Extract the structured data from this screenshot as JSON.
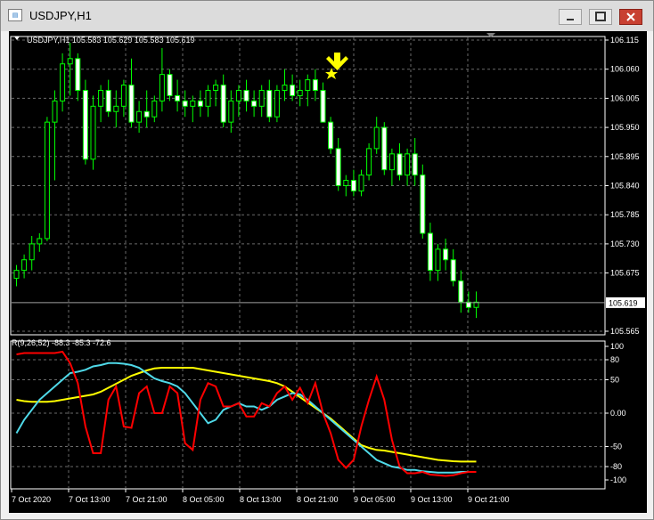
{
  "window": {
    "title": "USDJPY,H1"
  },
  "chart": {
    "header": "USDJPY,H1  105.583 105.629 105.583 105.619",
    "bid_label": "105.619",
    "price_labels": [
      "106.115",
      "106.060",
      "106.005",
      "105.950",
      "105.895",
      "105.840",
      "105.785",
      "105.730",
      "105.675",
      "105.565"
    ],
    "time_labels": [
      "7 Oct 2020",
      "7 Oct 13:00",
      "7 Oct 21:00",
      "8 Oct 05:00",
      "8 Oct 13:00",
      "8 Oct 21:00",
      "9 Oct 05:00",
      "9 Oct 13:00",
      "9 Oct 21:00"
    ],
    "signal_marks": [
      "down-arrow-icon",
      "star-icon"
    ]
  },
  "indicator": {
    "header": "R(9,26,52) -88.3 -85.3 -72.6",
    "levels": [
      "100",
      "80",
      "50",
      "0.00",
      "-50",
      "-80",
      "-100"
    ]
  },
  "colors": {
    "background": "#000000",
    "bull_candle": "#00ff00",
    "bear_candle": "#ffffff",
    "grid": "#6a6a6a",
    "signal": "#ffff00",
    "fast_line": "#ff0000",
    "mid_line": "#4fd9e8",
    "slow_line": "#ffff00"
  },
  "chart_data": {
    "type": "candlestick",
    "symbol": "USDJPY",
    "timeframe": "H1",
    "ylim": [
      105.565,
      106.115
    ],
    "candles": [
      [
        105.665,
        105.69,
        105.65,
        105.68
      ],
      [
        105.68,
        105.71,
        105.665,
        105.7
      ],
      [
        105.7,
        105.745,
        105.68,
        105.73
      ],
      [
        105.73,
        105.75,
        105.715,
        105.74
      ],
      [
        105.74,
        105.97,
        105.735,
        105.96
      ],
      [
        105.96,
        106.02,
        105.85,
        106.0
      ],
      [
        106.0,
        106.09,
        105.98,
        106.07
      ],
      [
        106.07,
        106.11,
        106.01,
        106.08
      ],
      [
        106.08,
        106.09,
        106.0,
        106.02
      ],
      [
        106.02,
        106.04,
        105.88,
        105.89
      ],
      [
        105.89,
        106.01,
        105.87,
        105.99
      ],
      [
        105.99,
        106.03,
        105.96,
        106.02
      ],
      [
        106.02,
        106.04,
        105.97,
        105.98
      ],
      [
        105.98,
        106.02,
        105.95,
        105.99
      ],
      [
        105.99,
        106.04,
        105.97,
        106.03
      ],
      [
        106.03,
        106.08,
        105.95,
        105.96
      ],
      [
        105.96,
        106.0,
        105.94,
        105.98
      ],
      [
        105.98,
        106.02,
        105.95,
        105.97
      ],
      [
        105.97,
        106.01,
        105.96,
        106.0
      ],
      [
        106.0,
        106.1,
        105.98,
        106.05
      ],
      [
        106.05,
        106.06,
        106.0,
        106.01
      ],
      [
        106.01,
        106.04,
        105.98,
        106.0
      ],
      [
        106.0,
        106.02,
        105.97,
        105.99
      ],
      [
        105.99,
        106.01,
        105.96,
        106.0
      ],
      [
        106.0,
        106.02,
        105.97,
        105.99
      ],
      [
        105.99,
        106.03,
        105.97,
        106.02
      ],
      [
        106.02,
        106.04,
        105.99,
        106.03
      ],
      [
        106.03,
        106.05,
        105.95,
        105.96
      ],
      [
        105.96,
        106.02,
        105.94,
        106.0
      ],
      [
        106.0,
        106.03,
        105.97,
        106.02
      ],
      [
        106.02,
        106.04,
        105.98,
        106.0
      ],
      [
        106.0,
        106.02,
        105.97,
        105.99
      ],
      [
        105.99,
        106.03,
        105.97,
        106.02
      ],
      [
        106.02,
        106.04,
        105.96,
        105.97
      ],
      [
        105.97,
        106.03,
        105.96,
        106.02
      ],
      [
        106.02,
        106.06,
        106.0,
        106.03
      ],
      [
        106.03,
        106.05,
        106.0,
        106.01
      ],
      [
        106.01,
        106.04,
        105.99,
        106.02
      ],
      [
        106.02,
        106.05,
        105.99,
        106.04
      ],
      [
        106.04,
        106.06,
        106.0,
        106.02
      ],
      [
        106.02,
        106.035,
        105.98,
        105.96
      ],
      [
        105.96,
        105.97,
        105.9,
        105.91
      ],
      [
        105.91,
        105.93,
        105.83,
        105.84
      ],
      [
        105.84,
        105.86,
        105.82,
        105.85
      ],
      [
        105.85,
        105.87,
        105.82,
        105.83
      ],
      [
        105.83,
        105.87,
        105.82,
        105.86
      ],
      [
        105.86,
        105.92,
        105.85,
        105.91
      ],
      [
        105.91,
        105.97,
        105.9,
        105.95
      ],
      [
        105.95,
        105.96,
        105.86,
        105.87
      ],
      [
        105.87,
        105.91,
        105.84,
        105.9
      ],
      [
        105.9,
        105.92,
        105.85,
        105.86
      ],
      [
        105.86,
        105.91,
        105.84,
        105.9
      ],
      [
        105.9,
        105.93,
        105.84,
        105.86
      ],
      [
        105.86,
        105.88,
        105.74,
        105.75
      ],
      [
        105.75,
        105.77,
        105.66,
        105.68
      ],
      [
        105.68,
        105.73,
        105.66,
        105.72
      ],
      [
        105.72,
        105.74,
        105.68,
        105.7
      ],
      [
        105.7,
        105.72,
        105.65,
        105.66
      ],
      [
        105.66,
        105.68,
        105.6,
        105.62
      ],
      [
        105.62,
        105.64,
        105.6,
        105.61
      ],
      [
        105.61,
        105.64,
        105.59,
        105.62
      ]
    ],
    "indicator": {
      "name": "R(9,26,52)",
      "values": [
        -88.3,
        -85.3,
        -72.6
      ],
      "ylim": [
        -100,
        100
      ],
      "levels": [
        100,
        80,
        50,
        0,
        -50,
        -80,
        -100
      ]
    }
  }
}
